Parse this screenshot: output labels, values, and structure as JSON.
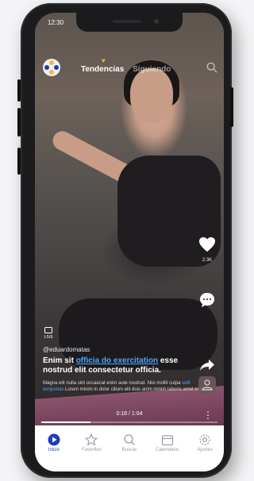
{
  "status_bar": {
    "time": "12:30"
  },
  "header": {
    "tabs": [
      {
        "label": "Tendencias",
        "active": true
      },
      {
        "label": "Siguiendo",
        "active": false
      }
    ],
    "search_icon": "search-icon",
    "logo_icon": "app-logo-icon"
  },
  "post": {
    "username": "@eduardomatas",
    "headline_start": "Enim sit ",
    "headline_link": "officia do exercitation",
    "headline_end": " esse nostrud elit consectetur officia.",
    "desc_start": "Magna elit nulla sint occaecat enim aute nostrud. Nisi mollit culpa ",
    "desc_link": "velit temporias",
    "desc_end": " Lorem minim in dolor cillum elit duis anim minim laboris amet est.",
    "time_readout": "0:18 / 1:04",
    "progress": 0.28,
    "live_label": "LIVE"
  },
  "actions": {
    "like_count": "2.3K",
    "like_icon": "heart-icon",
    "comment_icon": "comment-icon",
    "share_icon": "share-icon"
  },
  "bottom_nav": [
    {
      "label": "Inicio",
      "icon": "play-circle-icon",
      "active": true
    },
    {
      "label": "Favoritos",
      "icon": "star-icon",
      "active": false
    },
    {
      "label": "Buscar",
      "icon": "search-icon",
      "active": false
    },
    {
      "label": "Calendario",
      "icon": "calendar-icon",
      "active": false
    },
    {
      "label": "Ajustes",
      "icon": "gear-icon",
      "active": false
    }
  ],
  "colors": {
    "accent": "#1e3fb3",
    "link": "#4da6ff",
    "heart_badge": "#f2b84b"
  }
}
